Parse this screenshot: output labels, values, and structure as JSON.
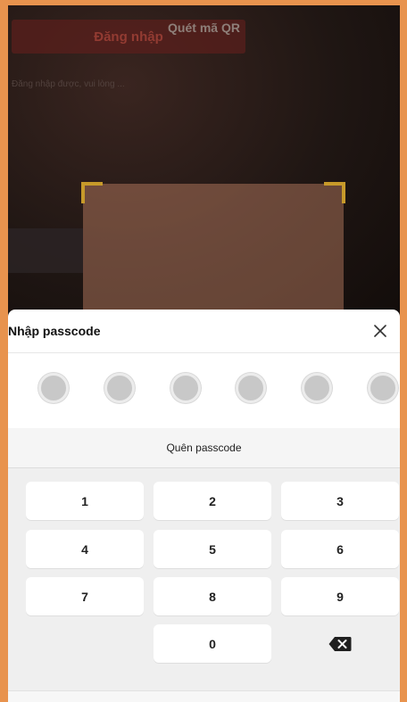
{
  "scanner": {
    "title": "Quét mã QR",
    "bg_login_label": "Đăng nhập",
    "bg_hint": "Đăng nhập được, vui lòng ..."
  },
  "sheet": {
    "title": "Nhập passcode",
    "close_symbol": "✕",
    "passcode_length": 6,
    "forgot_label": "Quên passcode"
  },
  "keypad": {
    "keys": [
      "1",
      "2",
      "3",
      "4",
      "5",
      "6",
      "7",
      "8",
      "9",
      "",
      "0",
      "backspace"
    ]
  },
  "colors": {
    "accent_border": "#e8934e",
    "scan_corner": "#c79a2a"
  }
}
